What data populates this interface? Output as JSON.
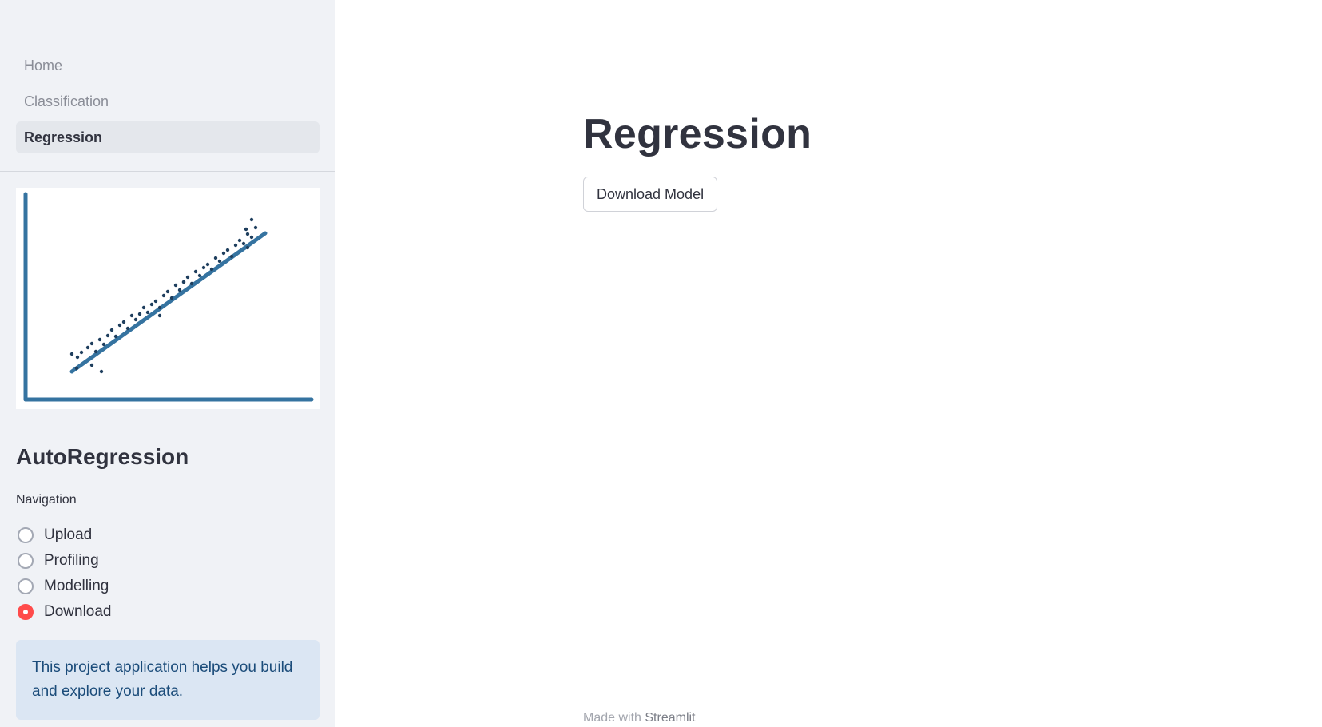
{
  "sidebar": {
    "nav_items": [
      {
        "label": "Home",
        "active": false
      },
      {
        "label": "Classification",
        "active": false
      },
      {
        "label": "Regression",
        "active": true
      }
    ],
    "title": "AutoRegression",
    "radio_group": {
      "label": "Navigation",
      "options": [
        {
          "label": "Upload",
          "checked": false
        },
        {
          "label": "Profiling",
          "checked": false
        },
        {
          "label": "Modelling",
          "checked": false
        },
        {
          "label": "Download",
          "checked": true
        }
      ]
    },
    "info_text": "This project application helps you build and explore your data."
  },
  "main": {
    "title": "Regression",
    "download_button_label": "Download Model"
  },
  "footer": {
    "prefix": "Made with",
    "brand": "Streamlit"
  },
  "colors": {
    "accent": "#ff4b4b",
    "sidebar_bg": "#f0f2f6",
    "info_bg": "#dbe6f3",
    "info_text": "#1b4c7a",
    "logo_line": "#3573a0",
    "logo_dots": "#1f3f5e"
  }
}
